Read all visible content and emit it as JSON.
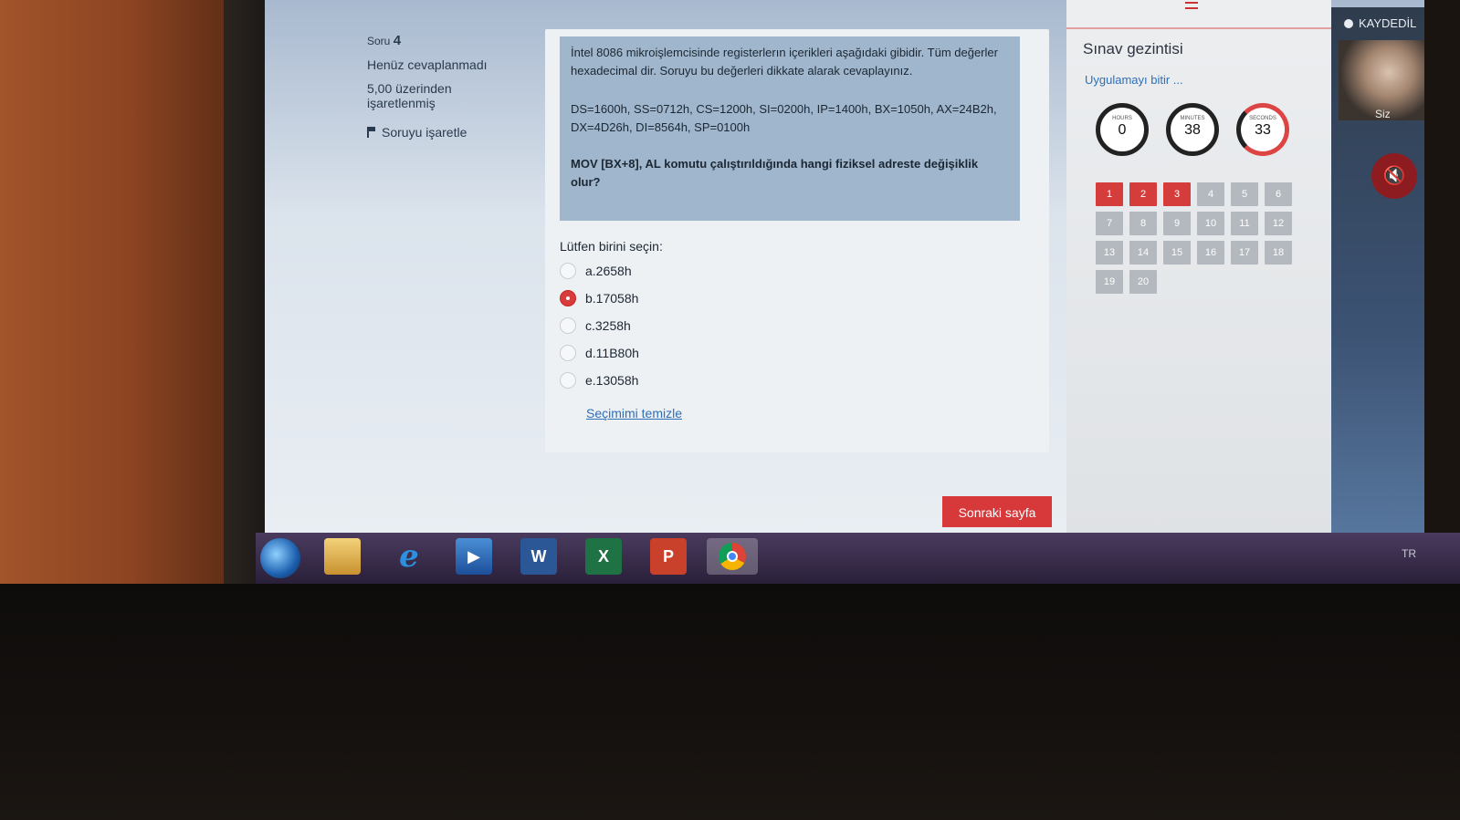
{
  "question_info": {
    "label": "Soru",
    "number": "4",
    "status": "Henüz cevaplanmadı",
    "score_line1": "5,00 üzerinden",
    "score_line2": "işaretlenmiş",
    "flag_label": "Soruyu işaretle"
  },
  "question": {
    "text_intro": "İntel 8086 mikroişlemcisinde registerlerın içerikleri aşağıdaki gibidir. Tüm değerler hexadecimal dir. Soruyu bu değerleri dikkate alarak cevaplayınız.",
    "registers": "DS=1600h, SS=0712h, CS=1200h, SI=0200h, IP=1400h, BX=1050h, AX=24B2h, DX=4D26h, DI=8564h, SP=0100h",
    "ask": "MOV [BX+8], AL komutu çalıştırıldığında hangi fiziksel adreste değişiklik olur?",
    "prompt": "Lütfen birini seçin:",
    "answers": [
      {
        "label": "a.2658h",
        "selected": false
      },
      {
        "label": "b.17058h",
        "selected": true
      },
      {
        "label": "c.3258h",
        "selected": false
      },
      {
        "label": "d.11B80h",
        "selected": false
      },
      {
        "label": "e.13058h",
        "selected": false
      }
    ],
    "clear_link": "Seçimimi temizle"
  },
  "next_button": "Sonraki sayfa",
  "nav": {
    "title": "Sınav gezintisi",
    "finish_link": "Uygulamayı bitir ...",
    "timer": {
      "hours_label": "HOURS",
      "hours": "0",
      "minutes_label": "MINUTES",
      "minutes": "38",
      "seconds_label": "SECONDS",
      "seconds": "33"
    },
    "questions": [
      "1",
      "2",
      "3",
      "4",
      "5",
      "6",
      "7",
      "8",
      "9",
      "10",
      "11",
      "12",
      "13",
      "14",
      "15",
      "16",
      "17",
      "18",
      "19",
      "20"
    ],
    "answered": [
      "1",
      "2",
      "3"
    ],
    "answered_color": "#d53d3d",
    "unanswered_color": "#b3b9bf"
  },
  "webcam": {
    "recording_label": "KAYDEDİL",
    "self_label": "Siz",
    "mic_icon": "mic-off-icon"
  },
  "taskbar": {
    "items": [
      "start-icon",
      "explorer-icon",
      "internet-explorer-icon",
      "media-player-icon",
      "word-icon",
      "excel-icon",
      "powerpoint-icon",
      "chrome-icon"
    ],
    "word_glyph": "W",
    "excel_glyph": "X",
    "ppt_glyph": "P",
    "language": "TR"
  },
  "colors": {
    "accent_red": "#d7383a",
    "link_blue": "#2f6fb7"
  }
}
